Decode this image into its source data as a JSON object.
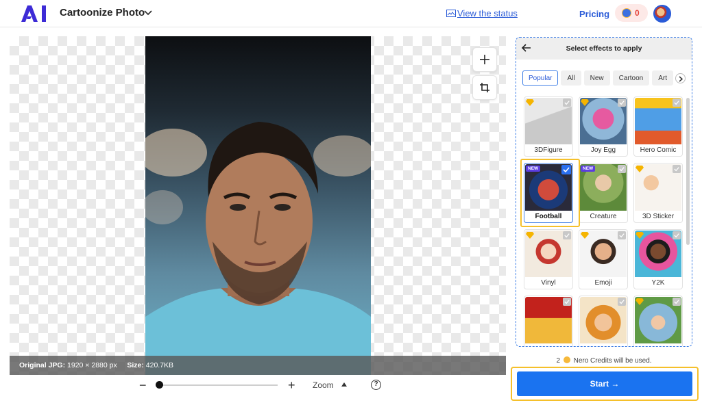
{
  "header": {
    "app_title": "Cartoonize Photo",
    "status_link": "View the status",
    "pricing": "Pricing",
    "credits": "0"
  },
  "canvas": {
    "info_original_label": "Original JPG:",
    "info_dimensions": "1920 × 2880 px",
    "info_size_label": "Size:",
    "info_size": "420.7KB"
  },
  "zoom": {
    "minus": "−",
    "plus": "+",
    "label": "Zoom",
    "help": "?",
    "level": 0.02
  },
  "panel": {
    "title": "Select effects to apply",
    "tabs": [
      "Popular",
      "All",
      "New",
      "Cartoon",
      "Art"
    ],
    "active_tab": "Popular",
    "effects": [
      {
        "label": "3DFigure",
        "badge": "gem",
        "selected": false
      },
      {
        "label": "Joy Egg",
        "badge": "gem",
        "selected": false
      },
      {
        "label": "Hero Comic",
        "badge": "none",
        "selected": false
      },
      {
        "label": "Football",
        "badge": "NEW",
        "selected": true
      },
      {
        "label": "Creature",
        "badge": "NEW",
        "selected": false
      },
      {
        "label": "3D Sticker",
        "badge": "gem",
        "selected": false
      },
      {
        "label": "Vinyl",
        "badge": "gem",
        "selected": false
      },
      {
        "label": "Emoji",
        "badge": "gem",
        "selected": false
      },
      {
        "label": "Y2K",
        "badge": "gem",
        "selected": false
      },
      {
        "label": "",
        "badge": "none",
        "selected": false
      },
      {
        "label": "",
        "badge": "none",
        "selected": false
      },
      {
        "label": "",
        "badge": "gem",
        "selected": false
      }
    ]
  },
  "footer": {
    "credits_count": "2",
    "credits_text": "Nero Credits will be used.",
    "start_label": "Start →"
  },
  "colors": {
    "accent": "#1a73f0",
    "highlight": "#f5c02b",
    "new_badge": "#5b3de0"
  }
}
